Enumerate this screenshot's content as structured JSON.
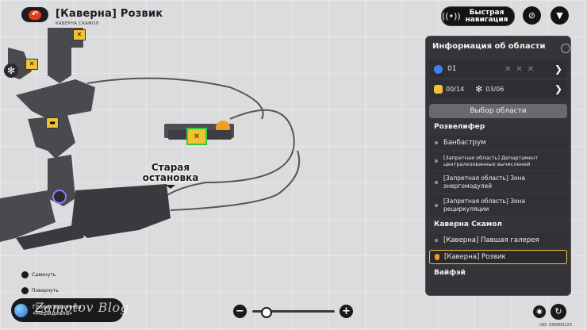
{
  "header": {
    "title": "[Каверна] Розвик",
    "subtitle": "КАВЕРНА СКАМОЛ",
    "quick_nav_label": "Быстрая навигация"
  },
  "map": {
    "label": "Старая остановка"
  },
  "panel": {
    "title": "Информация об области",
    "code": "01",
    "chests_progress": "00/14",
    "fans_progress": "03/06",
    "select_label": "Выбор области",
    "top_header": "Розвелифер",
    "items": [
      "Банбаструм",
      "[Запретная область] Департамент централизованных вычислений",
      "[Запретная область] Зона энергомодулей",
      "[Запретная область] Зона рециркуляции"
    ],
    "group_header": "Каверна Скамол",
    "items2": [
      "[Каверна] Павшая галерея",
      "[Каверна] Розвик"
    ],
    "bottom_header": "Вайфэй"
  },
  "hints": {
    "move": "Сдвинуть",
    "rotate": "Повернуть"
  },
  "nav_button": {
    "line1": "Гравитационная",
    "line2": "«Меридиана»"
  },
  "watermark": "Zamotov Blog",
  "footer_code": "UID: 000000123",
  "colors": {
    "accent_yellow": "#f0c430",
    "back_red": "#e23b1d",
    "panel_bg": "#26262a",
    "selected_marker": "#2ecc40"
  }
}
